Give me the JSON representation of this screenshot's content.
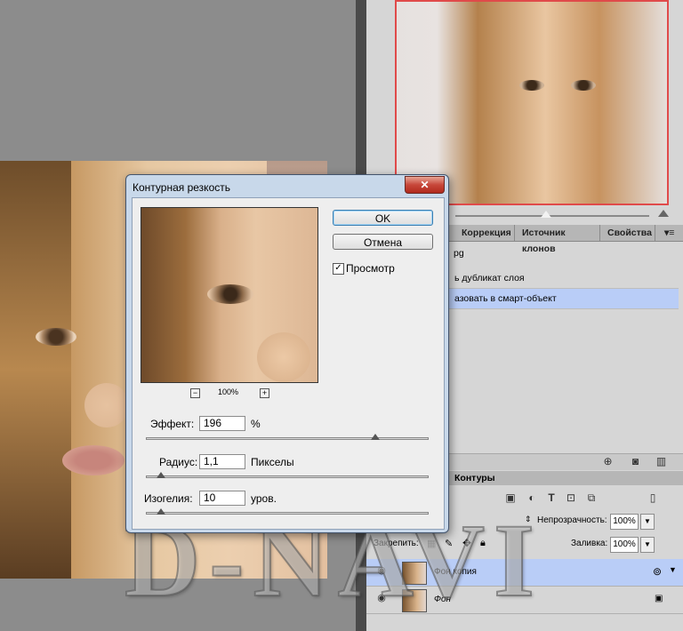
{
  "dialog": {
    "title": "Контурная резкость",
    "close_glyph": "✕",
    "ok_label": "OK",
    "cancel_label": "Отмена",
    "preview_label": "Просмотр",
    "preview_checked": true,
    "zoom_level": "100%",
    "zoom_out_glyph": "−",
    "zoom_in_glyph": "+",
    "effect": {
      "label": "Эффект:",
      "value": "196",
      "unit": "%",
      "slider_fraction": 0.8
    },
    "radius": {
      "label": "Радиус:",
      "value": "1,1",
      "unit": "Пикселы",
      "slider_fraction": 0.05
    },
    "threshold": {
      "label": "Изогелия:",
      "value": "10",
      "unit": "уров.",
      "slider_fraction": 0.05
    }
  },
  "panels": {
    "tabs": [
      "Коррекция",
      "Источник клонов",
      "Свойства"
    ],
    "history_file": "pg",
    "history_items": [
      "ь дубликат слоя",
      "азовать в смарт-объект"
    ],
    "layers_tab": "Контуры",
    "opacity_label": "Непрозрачность:",
    "opacity_value": "100%",
    "lock_label": "Закрепить:",
    "fill_label": "Заливка:",
    "fill_value": "100%",
    "layers": [
      {
        "name": "Фон копия",
        "selected": true
      },
      {
        "name": "Фон",
        "selected": false
      }
    ]
  },
  "watermark": "D-NAVI",
  "colors": {
    "accent_selection": "#b9cdf7",
    "dialog_frame": "#c8d8ea",
    "close_red": "#c7473a"
  }
}
